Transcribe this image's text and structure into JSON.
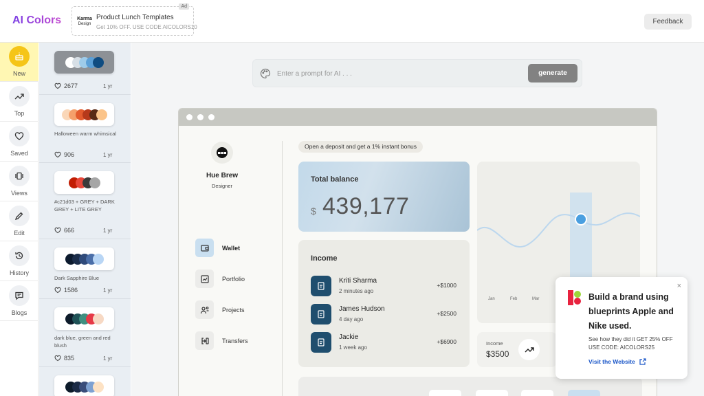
{
  "header": {
    "brand": "AI Colors",
    "ad": {
      "logo_line1": "Karma",
      "logo_line2": "Design",
      "title": "Product Lunch Templates",
      "subtitle": "Get 10% OFF. USE CODE AICOLORS10 ",
      "tag": "Ad"
    },
    "feedback_label": "Feedback"
  },
  "nav": {
    "items": [
      {
        "label": "New",
        "icon": "cake-icon",
        "active": true
      },
      {
        "label": "Top",
        "icon": "trending-up-icon"
      },
      {
        "label": "Saved",
        "icon": "heart-icon"
      },
      {
        "label": "Views",
        "icon": "carousel-icon"
      },
      {
        "label": "Edit",
        "icon": "pencil-icon"
      },
      {
        "label": "History",
        "icon": "history-icon"
      },
      {
        "label": "Blogs",
        "icon": "message-icon"
      }
    ]
  },
  "palettes": [
    {
      "name": "",
      "likes": "2677",
      "age": "1 yr",
      "colors": [
        "#ffffff",
        "#d7dfe6",
        "#9ecbe9",
        "#5b9fd6",
        "#0f4c81"
      ]
    },
    {
      "name": "Halloween warm whimsical",
      "likes": "906",
      "age": "1 yr",
      "colors": [
        "#fad7b8",
        "#f5a06b",
        "#e35b2d",
        "#b6391b",
        "#5a2a14",
        "#fbc48a"
      ]
    },
    {
      "name": "#c21d03 + GREY + DARK GREY + LITE GREY",
      "likes": "666",
      "age": "1 yr",
      "colors": [
        "#c21d03",
        "#e8473a",
        "#3a3a3a",
        "#a6a6a6"
      ]
    },
    {
      "name": "Dark Sapphire Blue",
      "likes": "1586",
      "age": "1 yr",
      "colors": [
        "#0c1a2e",
        "#1b2d4a",
        "#2f4a7a",
        "#4a6ea8",
        "#b9d6f5"
      ]
    },
    {
      "name": "dark blue, green and red blush",
      "likes": "835",
      "age": "1 yr",
      "colors": [
        "#0d1b2a",
        "#1f5257",
        "#3f8f80",
        "#e63946",
        "#f7d9c4"
      ]
    },
    {
      "name": "",
      "likes": "",
      "age": "",
      "colors": [
        "#0d1b2a",
        "#1b2b46",
        "#3a4d7a",
        "#7ea1d1",
        "#fde2c4"
      ]
    }
  ],
  "prompt": {
    "placeholder": "Enter a prompt for AI . . .",
    "generate_label": "generate"
  },
  "preview": {
    "user": {
      "name": "Hue Brew",
      "role": "Designer"
    },
    "menu": [
      {
        "label": "Wallet",
        "icon": "wallet-icon",
        "active": true
      },
      {
        "label": "Portfolio",
        "icon": "chart-icon"
      },
      {
        "label": "Projects",
        "icon": "people-icon"
      },
      {
        "label": "Transfers",
        "icon": "transfer-icon"
      }
    ],
    "banner": "Open a deposit and get a 1% instant bonus",
    "balance": {
      "title": "Total balance",
      "currency": "$",
      "value": "439,177"
    },
    "income": {
      "title": "Income",
      "transactions": [
        {
          "name": "Kriti Sharma",
          "time": "2 minutes ago",
          "amount": "+$1000"
        },
        {
          "name": "James Hudson",
          "time": "4 day ago",
          "amount": "+$2500"
        },
        {
          "name": "Jackie",
          "time": "1 week ago",
          "amount": "+$6900"
        }
      ]
    },
    "chart_months": [
      "Jan",
      "Feb",
      "Mar"
    ],
    "income_small": {
      "label": "Income",
      "value": "$3500"
    },
    "colors": {
      "accent": "#a9c3d6",
      "chart_line": "#bcd7ee",
      "point": "#4a9fe0"
    }
  },
  "popup": {
    "title": "Build a brand using blueprints Apple and Nike used.",
    "text": "See how they did it  GET 25% OFF USE CODE: AICOLORS25",
    "link": "Visit the Website",
    "close": "×"
  }
}
